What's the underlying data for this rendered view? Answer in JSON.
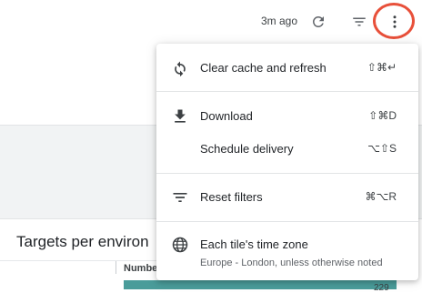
{
  "toolbar": {
    "last_updated": "3m ago",
    "refresh_icon": "refresh-icon",
    "filter_icon": "filter-icon",
    "more_icon": "more-vert-icon",
    "highlight_color": "#e8503a"
  },
  "menu": {
    "items": [
      {
        "icon": "sync-icon",
        "label": "Clear cache and refresh",
        "shortcut": "⇧⌘↵"
      },
      {
        "icon": "download-icon",
        "label": "Download",
        "shortcut": "⇧⌘D"
      },
      {
        "icon": "",
        "label": "Schedule delivery",
        "shortcut": "⌥⇧S"
      },
      {
        "icon": "filter-list-icon",
        "label": "Reset filters",
        "shortcut": "⌘⌥R"
      },
      {
        "icon": "globe-icon",
        "label": "Each tile's time zone",
        "sublabel": "Europe - London, unless otherwise noted"
      }
    ]
  },
  "tile": {
    "title": "Targets per environ",
    "column_header": "Numbe",
    "bar_value": "229",
    "bar_color": "#4a9c9a"
  }
}
